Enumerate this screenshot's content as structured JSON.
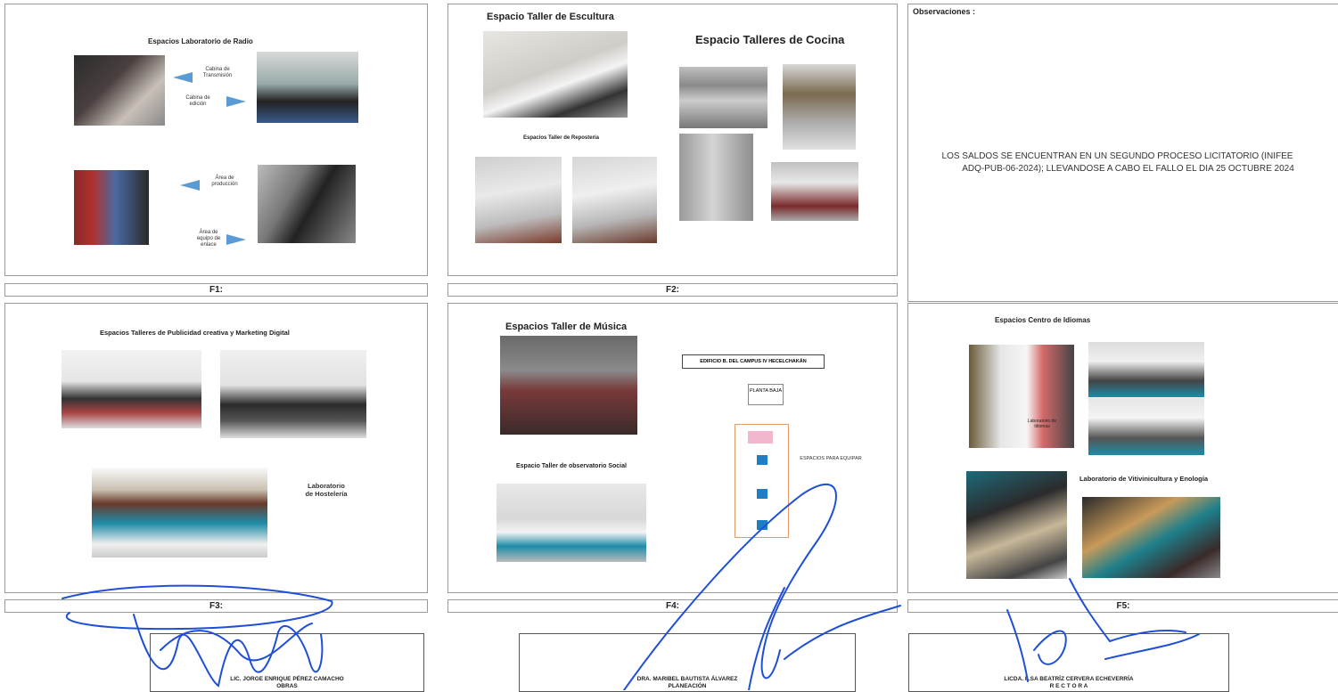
{
  "panels": {
    "f1": {
      "title": "Espacios Laboratorio de Radio",
      "label": "F1:",
      "captions": [
        "Cabina de Transmisión",
        "Cabina de edición",
        "Área de producción",
        "Área de equipo de enlace"
      ]
    },
    "f2": {
      "title_left": "Espacio Taller de Escultura",
      "title_right": "Espacio Talleres de Cocina",
      "subtitle": "Espacios Taller de Repostería",
      "label": "F2:"
    },
    "observations": {
      "heading": "Observaciones :",
      "line1": "LOS SALDOS SE ENCUENTRAN EN UN SEGUNDO PROCESO LICITATORIO (INIFEE",
      "line2": "ADQ-PUB-06-2024); LLEVANDOSE A CABO EL FALLO EL DIA 25 OCTUBRE 2024"
    },
    "f3": {
      "title": "Espacios Talleres de Publicidad creativa y Marketing Digital",
      "caption": "Laboratorio de Hostelería",
      "label": "F3:"
    },
    "f4": {
      "title": "Espacios Taller de Música",
      "subtitle": "Espacio Taller de observatorio Social",
      "plan_title": "EDIFICIO B. DEL CAMPUS IV HECELCHAKÁN",
      "plan_floor": "PLANTA BAJA",
      "plan_note": "ESPACIOS PARA EQUIPAR",
      "label": "F4:"
    },
    "f5": {
      "title": "Espacios Centro de Idiomas",
      "lab_title": "Laboratorio de Vitivinicultura y Enología",
      "photo_caption": "Laboratorio de Idiomas",
      "label": "F5:"
    }
  },
  "signatures": [
    {
      "name": "LIC. JORGE ENRIQUE PÉREZ CAMACHO",
      "role": "OBRAS"
    },
    {
      "name": "DRA. MARIBEL BAUTISTA ÁLVAREZ",
      "role": "PLANEACIÓN"
    },
    {
      "name": "LICDA. ILSA BEATRÍZ CERVERA ECHEVERRÍA",
      "role": "R E C T O R A"
    }
  ],
  "colors": {
    "ink": "#1f4fd6",
    "arrow": "#5b9bd5",
    "teal": "#1e8ba8"
  }
}
